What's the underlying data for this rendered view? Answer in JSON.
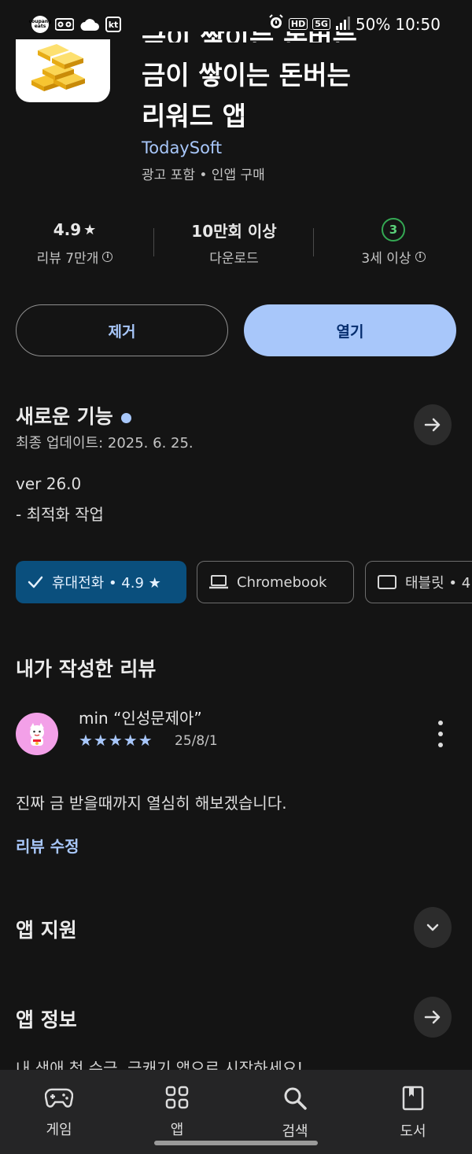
{
  "status_bar": {
    "left_icons": [
      "coupang-eats-icon",
      "voicemail-icon",
      "weather-cloud-icon",
      "kt-carrier-icon"
    ],
    "eats_text": "coupang eats",
    "kt_text": "kt",
    "hd_badge": "HD",
    "net_badge": "5G",
    "battery": "50%",
    "time": "10:50"
  },
  "app": {
    "title_line1": "금이 쌓이는 돈버는",
    "title_line2": "리워드 앱",
    "developer": "TodaySoft",
    "meta": "광고 포함 • 인앱 구매"
  },
  "stats": {
    "rating": "4.9",
    "rating_label": "리뷰 7만개",
    "downloads": "10만회 이상",
    "downloads_label": "다운로드",
    "age_badge": "3",
    "age_label": "3세 이상"
  },
  "actions": {
    "remove": "제거",
    "open": "열기"
  },
  "whats_new": {
    "title": "새로운 기능",
    "updated": "최종 업데이트: 2025. 6. 25.",
    "version": "ver 26.0",
    "notes": "- 최적화 작업"
  },
  "device_chips": {
    "phone": "휴대전화 • 4.9 ★",
    "chromebook": "Chromebook",
    "tablet": "태블릿 • 4"
  },
  "my_review": {
    "section_title": "내가 작성한 리뷰",
    "reviewer": "min “인성문제아”",
    "stars": "★★★★★",
    "rating_value": 5,
    "date": "25/8/1",
    "text": "진짜 금 받을때까지 열심히 해보겠습니다.",
    "edit_label": "리뷰 수정"
  },
  "sections": {
    "app_support": "앱 지원",
    "app_info": "앱 정보",
    "app_info_preview": "내 생애 첫 수금, 금캐기 앱으로 시작하세요!"
  },
  "bottom_nav": [
    {
      "label": "게임",
      "icon": "gamepad-icon"
    },
    {
      "label": "앱",
      "icon": "apps-grid-icon"
    },
    {
      "label": "검색",
      "icon": "search-icon"
    },
    {
      "label": "도서",
      "icon": "book-icon"
    }
  ],
  "colors": {
    "background": "#141414",
    "accent": "#a8c7fa",
    "chip_selected": "#0a4f7d",
    "age_badge": "#34a853",
    "nav_bg": "#252526"
  }
}
